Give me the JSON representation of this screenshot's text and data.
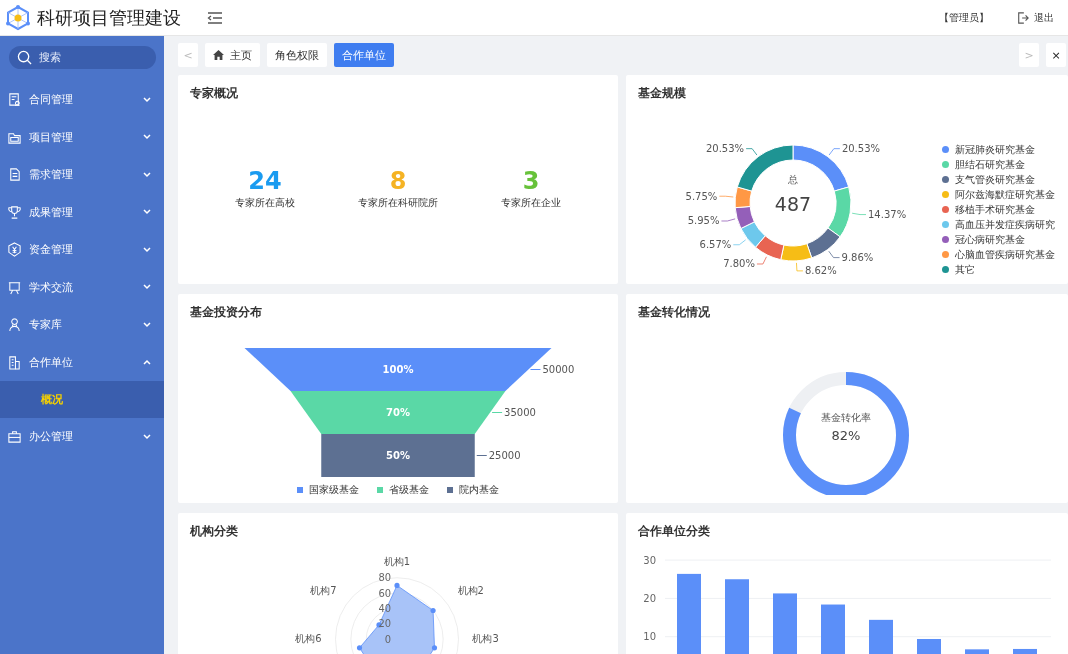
{
  "header": {
    "title": "科研项目管理建设",
    "user": "【管理员】",
    "logout": "退出"
  },
  "sidebar": {
    "search": {
      "placeholder": "搜索"
    },
    "items": [
      {
        "label": "合同管理",
        "expanded": false
      },
      {
        "label": "项目管理",
        "expanded": false
      },
      {
        "label": "需求管理",
        "expanded": false
      },
      {
        "label": "成果管理",
        "expanded": false
      },
      {
        "label": "资金管理",
        "expanded": false
      },
      {
        "label": "学术交流",
        "expanded": false
      },
      {
        "label": "专家库",
        "expanded": false
      },
      {
        "label": "合作单位",
        "expanded": true,
        "children": [
          {
            "label": "概况",
            "selected": true
          }
        ]
      },
      {
        "label": "办公管理",
        "expanded": false
      }
    ]
  },
  "tab_nav": {
    "prev": "<",
    "next": ">",
    "close": "×"
  },
  "tabs": [
    {
      "label": "主页",
      "kind": "home",
      "selected": false
    },
    {
      "label": "角色权限",
      "kind": "plain",
      "selected": false
    },
    {
      "label": "合作单位",
      "kind": "plain",
      "selected": true
    }
  ],
  "experts": {
    "title": "专家概况",
    "stats": [
      {
        "value": "24",
        "label": "专家所在高校",
        "color": "#1a9bf0"
      },
      {
        "value": "8",
        "label": "专家所在科研院所",
        "color": "#f5b324"
      },
      {
        "value": "3",
        "label": "专家所在企业",
        "color": "#67c23a"
      }
    ]
  },
  "fund_scale": {
    "title": "基金规模",
    "center_label": "总",
    "center_value": "487",
    "chart_data": {
      "type": "donut",
      "categories": [
        "新冠肺炎研究基金",
        "胆结石研究基金",
        "支气管炎研究基金",
        "阿尔兹海默症研究基金",
        "移植手术研究基金",
        "高血压并发症疾病研究",
        "冠心病研究基金",
        "心脑血管疾病研究基金",
        "其它"
      ],
      "values": [
        20.53,
        14.37,
        9.86,
        8.62,
        7.8,
        6.57,
        5.95,
        5.75,
        20.53
      ],
      "colors": [
        "#5b8ff9",
        "#5ad8a6",
        "#5d7092",
        "#f6bd16",
        "#e86452",
        "#6dc8ec",
        "#945fb9",
        "#ff9845",
        "#1e9493"
      ],
      "value_labels": [
        "20.53%",
        "14.37%",
        "9.86%",
        "8.62%",
        "7.80%",
        "6.57%",
        "5.95%",
        "5.75%",
        "20.53%"
      ]
    }
  },
  "fund_distribution": {
    "title": "基金投资分布",
    "stages": [
      {
        "name": "国家级基金",
        "color": "#5b8ff9",
        "percent": "100%",
        "value": "50000"
      },
      {
        "name": "省级基金",
        "color": "#5ad8a6",
        "percent": "70%",
        "value": "35000"
      },
      {
        "name": "院内基金",
        "color": "#5d7092",
        "percent": "50%",
        "value": "25000"
      }
    ]
  },
  "fund_conversion": {
    "title": "基金转化情况",
    "label": "基金转化率",
    "reading": "82%"
  },
  "institutions": {
    "title": "机构分类",
    "axis_labels": [
      "机构1",
      "机构2",
      "机构3",
      "机构6",
      "机构7"
    ],
    "scale": [
      "80",
      "60",
      "40",
      "20",
      "0"
    ]
  },
  "partners": {
    "title": "合作单位分类",
    "scale": [
      "30",
      "20",
      "10"
    ]
  }
}
